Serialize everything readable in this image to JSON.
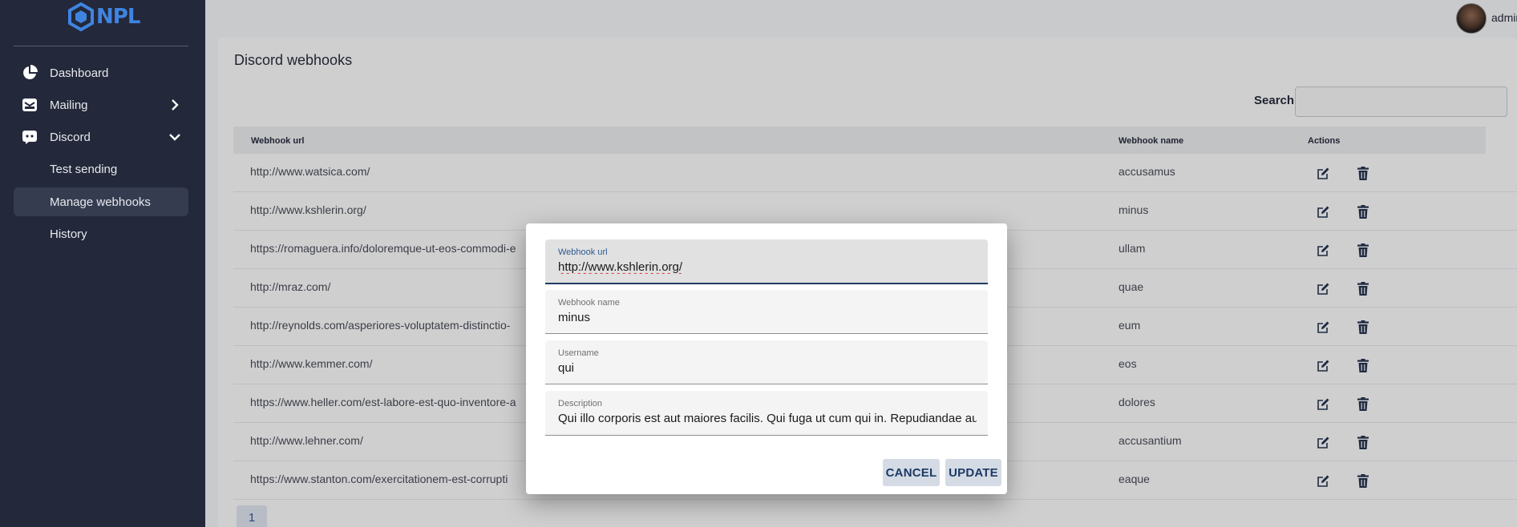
{
  "brand": {
    "logo_text": "NPL",
    "logo_color": "#3f84e0"
  },
  "sidebar": {
    "dashboard": "Dashboard",
    "mailing": "Mailing",
    "discord": "Discord",
    "discord_children": [
      "Test sending",
      "Manage webhooks",
      "History"
    ],
    "active_item": "Manage webhooks"
  },
  "header": {
    "user": "admin"
  },
  "page": {
    "title": "Discord webhooks",
    "search_label": "Search",
    "search_value": ""
  },
  "table": {
    "columns": [
      "Webhook url",
      "Webhook name",
      "Actions"
    ],
    "rows": [
      {
        "url": "http://www.watsica.com/",
        "name": "accusamus"
      },
      {
        "url": "http://www.kshlerin.org/",
        "name": "minus"
      },
      {
        "url": "https://romaguera.info/doloremque-ut-eos-commodi-e",
        "name": "ullam"
      },
      {
        "url": "http://mraz.com/",
        "name": "quae"
      },
      {
        "url": "http://reynolds.com/asperiores-voluptatem-distinctio-",
        "name": "eum"
      },
      {
        "url": "http://www.kemmer.com/",
        "name": "eos"
      },
      {
        "url": "https://www.heller.com/est-labore-est-quo-inventore-a",
        "name": "dolores"
      },
      {
        "url": "http://www.lehner.com/",
        "name": "accusantium"
      },
      {
        "url": "https://www.stanton.com/exercitationem-est-corrupti",
        "name": "eaque"
      }
    ],
    "action_icons": [
      "edit-icon",
      "trash-icon"
    ]
  },
  "pagination": {
    "current": "1"
  },
  "modal": {
    "fields": [
      {
        "label": "Webhook url",
        "value": "http://www.kshlerin.org/"
      },
      {
        "label": "Webhook name",
        "value": "minus"
      },
      {
        "label": "Username",
        "value": "qui"
      },
      {
        "label": "Description",
        "value": "Qui illo corporis est aut maiores facilis. Qui fuga ut cum qui in. Repudiandae autem"
      }
    ],
    "cancel": "CANCEL",
    "update": "UPDATE"
  }
}
